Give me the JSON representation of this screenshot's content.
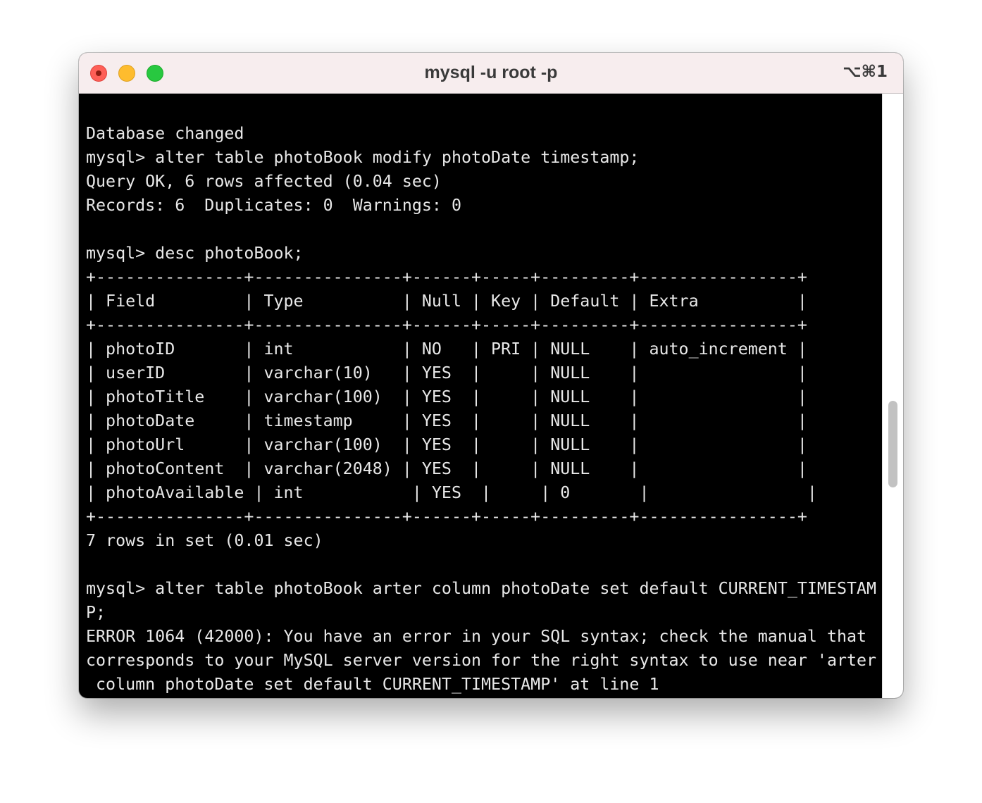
{
  "window": {
    "title": "mysql -u root -p",
    "shortcut": "⌥⌘1",
    "colors": {
      "titlebar": "#f7edee",
      "terminal_bg": "#000000",
      "terminal_fg": "#e8e8e8",
      "close": "#fe5f57",
      "minimize": "#febc2e",
      "zoom": "#28c840"
    }
  },
  "terminal": {
    "lines": [
      "Database changed",
      "mysql> alter table photoBook modify photoDate timestamp;",
      "Query OK, 6 rows affected (0.04 sec)",
      "Records: 6  Duplicates: 0  Warnings: 0",
      "",
      "mysql> desc photoBook;",
      "+---------------+---------------+------+-----+---------+----------------+",
      "| Field         | Type          | Null | Key | Default | Extra          |",
      "+---------------+---------------+------+-----+---------+----------------+",
      "| photoID       | int           | NO   | PRI | NULL    | auto_increment |",
      "| userID        | varchar(10)   | YES  |     | NULL    |                |",
      "| photoTitle    | varchar(100)  | YES  |     | NULL    |                |",
      "| photoDate     | timestamp     | YES  |     | NULL    |                |",
      "| photoUrl      | varchar(100)  | YES  |     | NULL    |                |",
      "| photoContent  | varchar(2048) | YES  |     | NULL    |                |",
      "| photoAvailable | int           | YES  |     | 0       |                |",
      "+---------------+---------------+------+-----+---------+----------------+",
      "7 rows in set (0.01 sec)",
      "",
      "mysql> alter table photoBook arter column photoDate set default CURRENT_TIMESTAM",
      "P;",
      "ERROR 1064 (42000): You have an error in your SQL syntax; check the manual that",
      "corresponds to your MySQL server version for the right syntax to use near 'arter",
      " column photoDate set default CURRENT_TIMESTAMP' at line 1"
    ]
  }
}
